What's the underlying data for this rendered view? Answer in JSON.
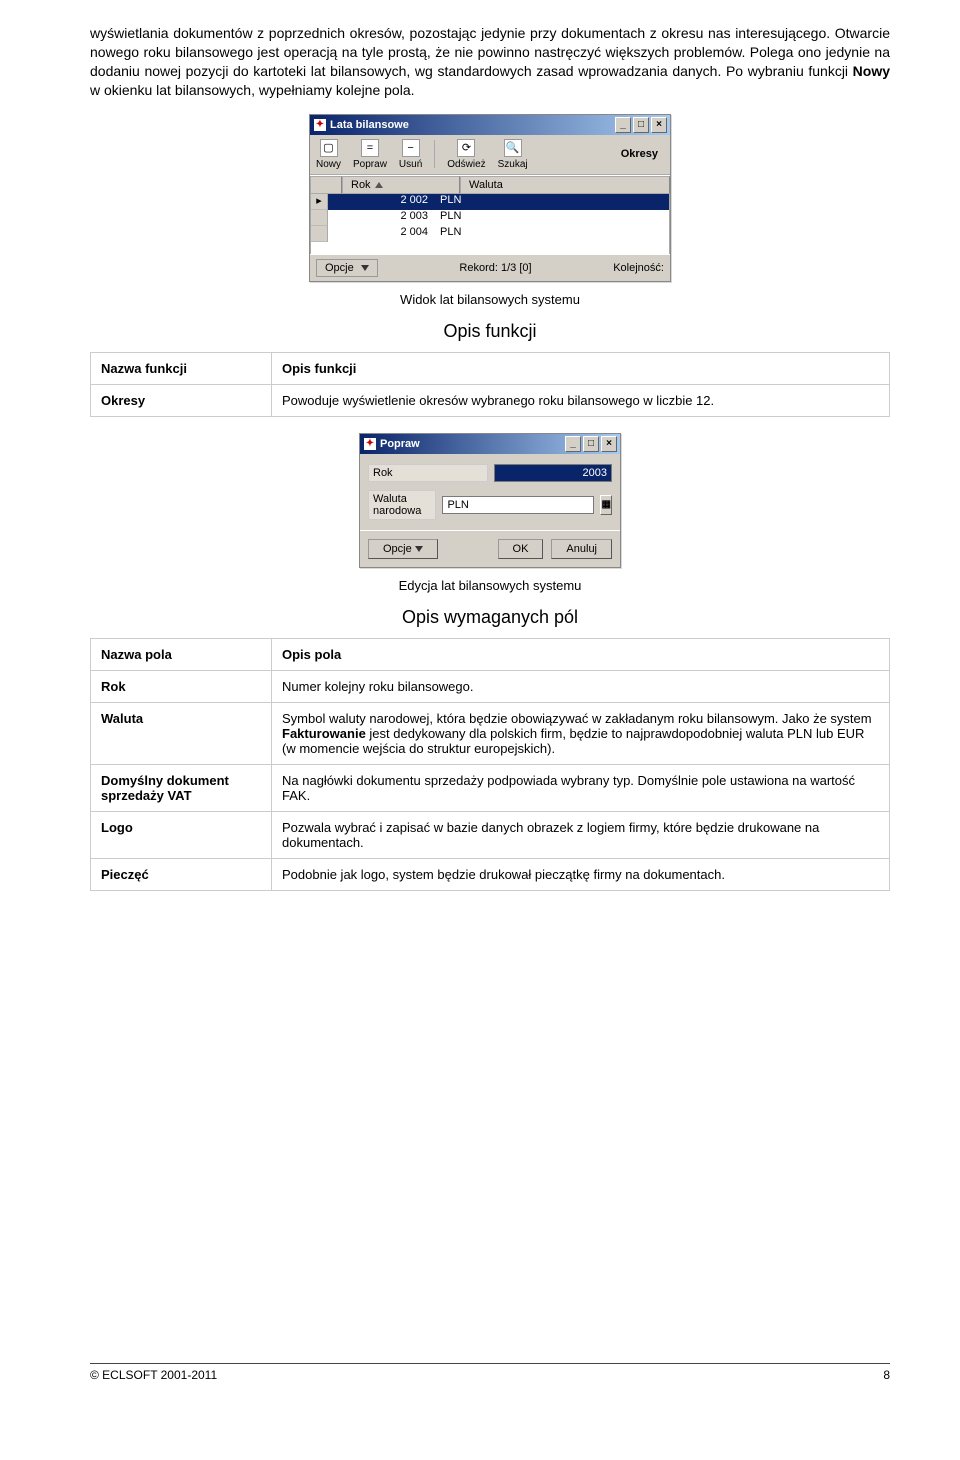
{
  "intro_html": "wyświetlania dokumentów z poprzednich okresów, pozostając jedynie przy dokumentach z okresu nas interesującego. Otwarcie nowego roku bilansowego jest operacją na tyle prostą, że nie powinno nastręczyć większych problemów. Polega ono jedynie na dodaniu nowej pozycji do kartoteki lat bilansowych, wg standardowych zasad wprowadzania danych. Po wybraniu funkcji <b>Nowy</b> w okienku lat bilansowych, wypełniamy kolejne pola.",
  "win1": {
    "title": "Lata bilansowe",
    "toolbar": {
      "nowy": "Nowy",
      "popraw": "Popraw",
      "usun": "Usuń",
      "odswiez": "Odśwież",
      "szukaj": "Szukaj",
      "okresy": "Okresy"
    },
    "cols": {
      "rok": "Rok",
      "waluta": "Waluta"
    },
    "rows": [
      {
        "rok": "2 002",
        "waluta": "PLN"
      },
      {
        "rok": "2 003",
        "waluta": "PLN"
      },
      {
        "rok": "2 004",
        "waluta": "PLN"
      }
    ],
    "status": {
      "opcje": "Opcje",
      "rekord": "Rekord: 1/3 [0]",
      "kolejnosc": "Kolejność:"
    }
  },
  "caption1": "Widok lat bilansowych systemu",
  "section_opis_funkcji": "Opis funkcji",
  "table1": {
    "h1": "Nazwa funkcji",
    "h2": "Opis funkcji",
    "rows": [
      {
        "name": "Okresy",
        "desc": "Powoduje wyświetlenie okresów wybranego roku bilansowego w liczbie 12."
      }
    ]
  },
  "win2": {
    "title": "Popraw",
    "labels": {
      "rok": "Rok",
      "waluta": "Waluta narodowa"
    },
    "values": {
      "rok": "2003",
      "waluta": "PLN"
    },
    "buttons": {
      "opcje": "Opcje",
      "ok": "OK",
      "anuluj": "Anuluj"
    }
  },
  "caption2": "Edycja lat bilansowych systemu",
  "section_opis_pol": "Opis wymaganych pól",
  "table2": {
    "h1": "Nazwa pola",
    "h2": "Opis pola",
    "rows": [
      {
        "name": "Rok",
        "desc": "Numer kolejny roku bilansowego."
      },
      {
        "name": "Waluta",
        "desc_html": "Symbol waluty narodowej, która będzie obowiązywać w zakładanym roku bilansowym. Jako że system <b>Fakturowanie</b> jest dedykowany dla polskich firm, będzie to najprawdopodobniej waluta PLN lub EUR (w momencie wejścia do struktur europejskich)."
      },
      {
        "name": "Domyślny dokument sprzedaży VAT",
        "desc": "Na nagłówki dokumentu sprzedaży podpowiada wybrany typ. Domyślnie pole ustawiona na wartość FAK."
      },
      {
        "name": "Logo",
        "desc": "Pozwala wybrać i zapisać w bazie danych obrazek z logiem firmy, które będzie drukowane na dokumentach."
      },
      {
        "name": "Pieczęć",
        "desc": "Podobnie jak logo, system będzie drukował pieczątkę firmy na dokumentach."
      }
    ]
  },
  "footer": {
    "left": "© ECLSOFT 2001-2011",
    "right": "8"
  }
}
